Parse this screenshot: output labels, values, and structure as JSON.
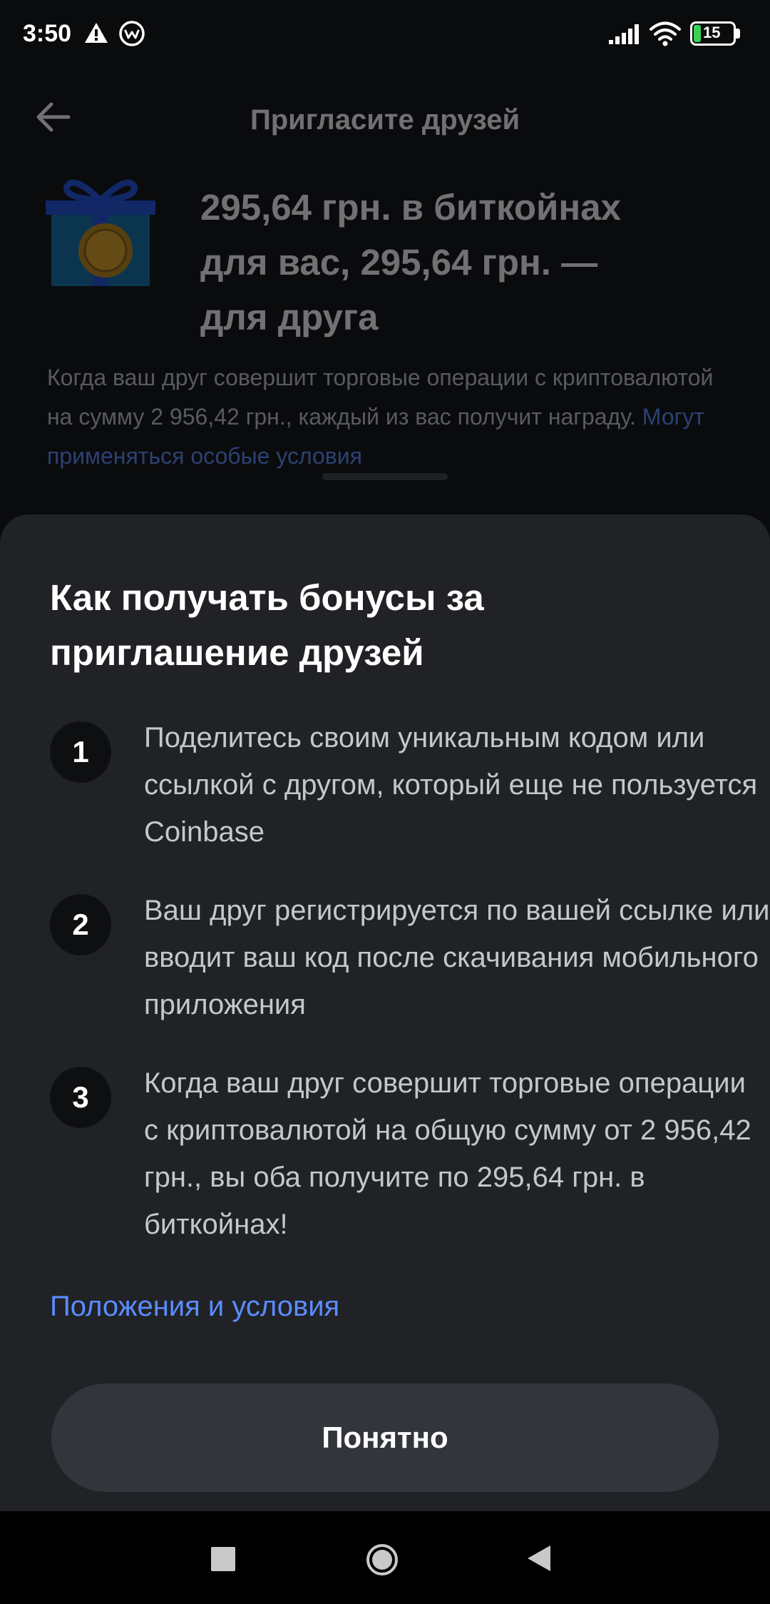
{
  "status_bar": {
    "time": "3:50",
    "battery_level": "15",
    "icons": [
      "warning-icon",
      "circle-w-icon",
      "signal-icon",
      "wifi-icon",
      "battery-icon"
    ]
  },
  "header": {
    "title": "Пригласите друзей",
    "back_icon": "arrow-left-icon"
  },
  "promo": {
    "gift_icon": "gift-icon",
    "headline": "295,64 грн. в биткойнах для вас, 295,64 грн. — для друга",
    "description": "Когда ваш друг совершит торговые операции с криптовалютой на сумму 2 956,42 грн., каждый из вас получит награду.",
    "conditions_link": "Могут применяться особые условия"
  },
  "sheet": {
    "title": "Как получать бонусы за приглашение друзей",
    "steps": [
      {
        "number": "1",
        "text": "Поделитесь своим уникальным кодом или ссылкой с другом, который еще не пользуется Coinbase"
      },
      {
        "number": "2",
        "text": "Ваш друг регистрируется по вашей ссылке или вводит ваш код после скачивания мобильного приложения"
      },
      {
        "number": "3",
        "text": "Когда ваш друг совершит торговые операции с криптовалютой на общую сумму от 2 956,42 грн., вы оба получите по 295,64 грн. в биткойнах!"
      }
    ],
    "terms_link": "Положения и условия",
    "ok_button": "Понятно"
  },
  "nav_bar": {
    "icons": [
      "recents-square-icon",
      "home-circle-icon",
      "back-triangle-icon"
    ]
  },
  "colors": {
    "sheet_bg": "#202226",
    "link": "#5b8cff",
    "button_bg": "#32353b",
    "battery_green": "#39d353"
  }
}
